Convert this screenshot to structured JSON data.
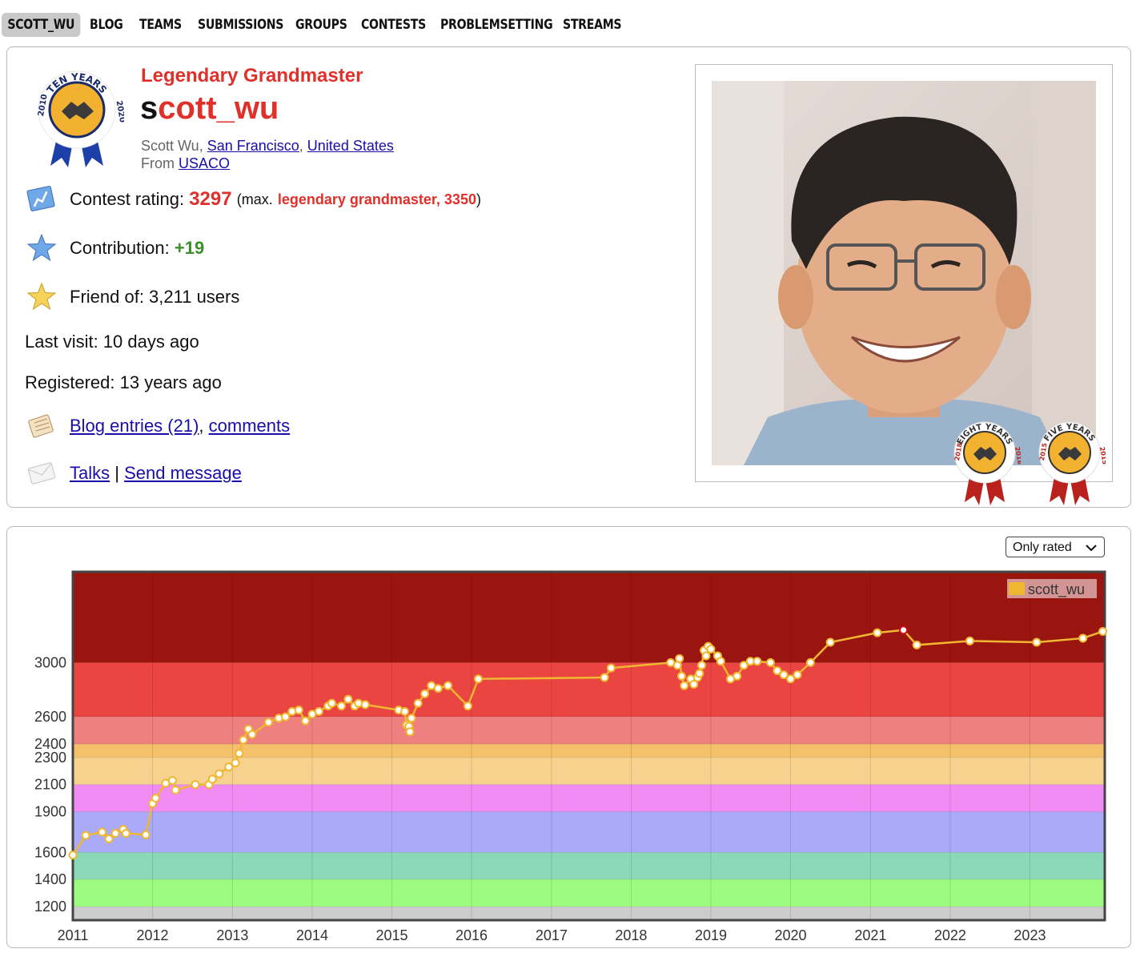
{
  "nav": {
    "items": [
      "SCOTT_WU",
      "BLOG",
      "TEAMS",
      "SUBMISSIONS",
      "GROUPS",
      "CONTESTS",
      "PROBLEMSETTING",
      "STREAMS"
    ]
  },
  "profile": {
    "badge_years_label": "TEN YEARS",
    "badge_year_left": "2010",
    "badge_year_right": "2020",
    "rank": "Legendary Grandmaster",
    "handle_first": "s",
    "handle_rest": "cott_wu",
    "name": "Scott Wu",
    "city": "San Francisco",
    "country": "United States",
    "from_label": "From",
    "organization": "USACO",
    "contest_rating_label": "Contest rating:",
    "contest_rating": "3297",
    "max_prefix": "(max.",
    "max_rank": "legendary grandmaster, 3350",
    "max_suffix": ")",
    "contribution_label": "Contribution:",
    "contribution": "+19",
    "friend_of": "Friend of: 3,211 users",
    "last_visit": "Last visit: 10 days ago",
    "registered": "Registered: 13 years ago",
    "blog_entries": "Blog entries (21)",
    "comments": "comments",
    "talks": "Talks",
    "separator": "|",
    "send_message": "Send message",
    "medal_eight": {
      "label": "EIGHT YEARS",
      "y1": "2018",
      "y2": "2018"
    },
    "medal_five": {
      "label": "FIVE YEARS",
      "y1": "2015",
      "y2": "2015"
    }
  },
  "graph": {
    "filter": "Only rated",
    "colors": {
      "series": "#f0b830",
      "legendary": "#9b1510",
      "igm": "#ea4540",
      "gm": "#ef8080",
      "im": "#f4c06a",
      "master": "#f6d28e",
      "cm": "#f08cf4",
      "expert": "#aaaaf8",
      "specialist": "#8ad8b8",
      "pupil": "#9cfc80",
      "newbie": "#cccccc"
    }
  },
  "chart_data": {
    "type": "line",
    "series": [
      {
        "name": "scott_wu",
        "points": [
          [
            "2011-01-01",
            1580
          ],
          [
            "2011-03-01",
            1725
          ],
          [
            "2011-05-15",
            1750
          ],
          [
            "2011-06-15",
            1700
          ],
          [
            "2011-07-15",
            1740
          ],
          [
            "2011-08-20",
            1770
          ],
          [
            "2011-09-01",
            1740
          ],
          [
            "2011-12-01",
            1730
          ],
          [
            "2012-01-01",
            1960
          ],
          [
            "2012-01-15",
            2000
          ],
          [
            "2012-03-01",
            2110
          ],
          [
            "2012-04-01",
            2130
          ],
          [
            "2012-04-15",
            2060
          ],
          [
            "2012-07-15",
            2100
          ],
          [
            "2012-09-15",
            2100
          ],
          [
            "2012-10-01",
            2140
          ],
          [
            "2012-11-01",
            2180
          ],
          [
            "2012-12-15",
            2230
          ],
          [
            "2013-01-15",
            2260
          ],
          [
            "2013-02-01",
            2330
          ],
          [
            "2013-02-20",
            2430
          ],
          [
            "2013-03-15",
            2510
          ],
          [
            "2013-04-01",
            2470
          ],
          [
            "2013-06-15",
            2560
          ],
          [
            "2013-08-01",
            2590
          ],
          [
            "2013-09-01",
            2600
          ],
          [
            "2013-10-01",
            2640
          ],
          [
            "2013-11-01",
            2650
          ],
          [
            "2013-12-01",
            2570
          ],
          [
            "2014-01-01",
            2620
          ],
          [
            "2014-02-01",
            2640
          ],
          [
            "2014-03-15",
            2680
          ],
          [
            "2014-04-01",
            2700
          ],
          [
            "2014-05-15",
            2680
          ],
          [
            "2014-06-15",
            2730
          ],
          [
            "2014-07-15",
            2680
          ],
          [
            "2014-08-01",
            2700
          ],
          [
            "2014-09-01",
            2690
          ],
          [
            "2015-02-01",
            2650
          ],
          [
            "2015-03-01",
            2640
          ],
          [
            "2015-03-10",
            2540
          ],
          [
            "2015-03-20",
            2530
          ],
          [
            "2015-03-25",
            2490
          ],
          [
            "2015-04-01",
            2590
          ],
          [
            "2015-05-01",
            2700
          ],
          [
            "2015-06-01",
            2770
          ],
          [
            "2015-07-01",
            2830
          ],
          [
            "2015-08-01",
            2810
          ],
          [
            "2015-09-15",
            2830
          ],
          [
            "2015-12-15",
            2680
          ],
          [
            "2016-02-01",
            2880
          ],
          [
            "2017-09-01",
            2890
          ],
          [
            "2017-10-01",
            2960
          ],
          [
            "2018-07-01",
            3000
          ],
          [
            "2018-08-01",
            2980
          ],
          [
            "2018-08-10",
            3030
          ],
          [
            "2018-08-20",
            2900
          ],
          [
            "2018-09-01",
            2830
          ],
          [
            "2018-10-01",
            2880
          ],
          [
            "2018-10-15",
            2840
          ],
          [
            "2018-11-01",
            2890
          ],
          [
            "2018-11-10",
            2920
          ],
          [
            "2018-11-20",
            2980
          ],
          [
            "2018-12-01",
            3090
          ],
          [
            "2018-12-10",
            3050
          ],
          [
            "2018-12-20",
            3120
          ],
          [
            "2019-01-01",
            3100
          ],
          [
            "2019-02-01",
            3050
          ],
          [
            "2019-02-15",
            3010
          ],
          [
            "2019-04-01",
            2880
          ],
          [
            "2019-05-01",
            2900
          ],
          [
            "2019-06-01",
            2980
          ],
          [
            "2019-07-01",
            3010
          ],
          [
            "2019-08-01",
            3010
          ],
          [
            "2019-10-01",
            3000
          ],
          [
            "2019-11-01",
            2940
          ],
          [
            "2019-12-01",
            2910
          ],
          [
            "2020-01-01",
            2880
          ],
          [
            "2020-02-01",
            2910
          ],
          [
            "2020-04-01",
            3000
          ],
          [
            "2020-07-01",
            3150
          ],
          [
            "2021-02-01",
            3220
          ],
          [
            "2021-06-01",
            3240
          ],
          [
            "2021-08-01",
            3130
          ],
          [
            "2022-04-01",
            3160
          ],
          [
            "2023-02-01",
            3150
          ],
          [
            "2023-09-01",
            3180
          ],
          [
            "2023-12-01",
            3230
          ]
        ]
      }
    ],
    "y_ticks": [
      1200,
      1400,
      1600,
      1900,
      2100,
      2300,
      2400,
      2600,
      3000
    ],
    "x_ticks": [
      "2011",
      "2012",
      "2013",
      "2014",
      "2015",
      "2016",
      "2017",
      "2018",
      "2019",
      "2020",
      "2021",
      "2022",
      "2023"
    ],
    "ylim": [
      1100,
      3670
    ],
    "xlim": [
      "2011-01-01",
      "2023-12-10"
    ],
    "max_point": [
      "2021-06-01",
      3240
    ],
    "legend": "top-right",
    "grid": true
  }
}
